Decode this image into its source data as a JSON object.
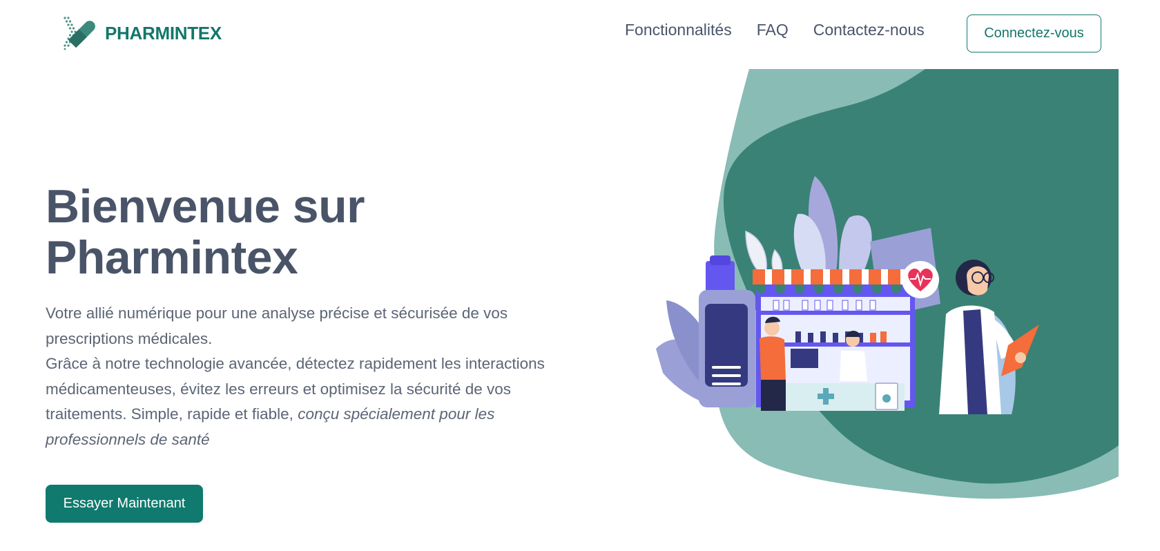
{
  "header": {
    "logo_text": "PHARMINTEX",
    "nav": [
      {
        "label": "Fonctionnalités"
      },
      {
        "label": "FAQ"
      },
      {
        "label": "Contactez-nous"
      }
    ],
    "login_label": "Connectez-vous"
  },
  "hero": {
    "title_line1": "Bienvenue sur",
    "title_line2": "Pharmintex",
    "paragraph_1": "Votre allié numérique pour une analyse précise et sécurisée de vos prescriptions médicales.",
    "paragraph_2": "Grâce à notre technologie avancée, détectez rapidement les interactions médicamenteuses, évitez les erreurs et optimisez la sécurité de vos traitements. Simple, rapide et fiable, ",
    "paragraph_2_emphasis": "conçu spécialement pour les professionnels de santé",
    "cta_label": "Essayer Maintenant"
  },
  "colors": {
    "brand": "#12776a",
    "cta": "#0f7a6d",
    "text_dark": "#4a5468",
    "text_body": "#5c6575",
    "blob_dark": "#3a8275",
    "blob_light": "#88bcb4",
    "pharmacy_purple": "#6457f0",
    "awning_orange": "#f46d3a"
  },
  "icons": {
    "logo": "pharmintex-logo-icon",
    "heart": "heartbeat-icon",
    "cross": "medical-cross-icon"
  }
}
